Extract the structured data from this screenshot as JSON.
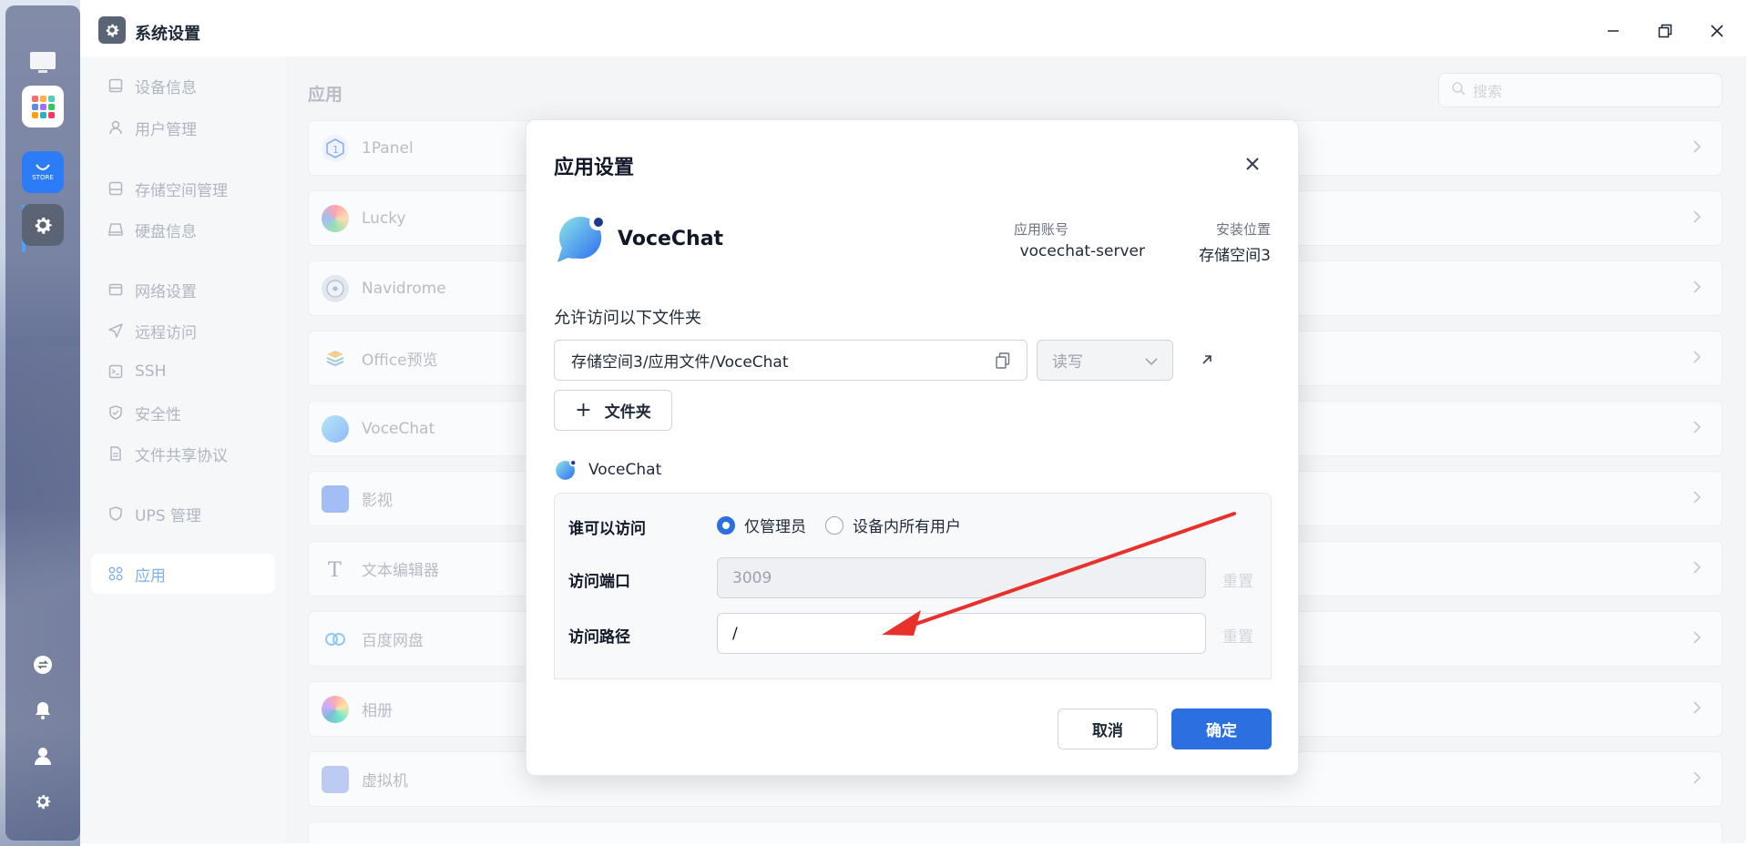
{
  "window": {
    "title": "系统设置"
  },
  "dock": {
    "items": [
      "monitor-icon",
      "apps-grid-icon",
      "store-icon",
      "settings-icon",
      "sync-icon",
      "bell-icon",
      "user-icon",
      "gear-icon"
    ],
    "store_label": "STORE"
  },
  "sidebar": {
    "items": [
      {
        "label": "设备信息",
        "icon": "device-icon"
      },
      {
        "label": "用户管理",
        "icon": "user-icon"
      },
      {
        "label": "存储空间管理",
        "icon": "storage-icon"
      },
      {
        "label": "硬盘信息",
        "icon": "disk-icon"
      },
      {
        "label": "网络设置",
        "icon": "network-icon"
      },
      {
        "label": "远程访问",
        "icon": "send-icon"
      },
      {
        "label": "SSH",
        "icon": "terminal-icon"
      },
      {
        "label": "安全性",
        "icon": "shield-check-icon"
      },
      {
        "label": "文件共享协议",
        "icon": "file-icon"
      },
      {
        "label": "UPS 管理",
        "icon": "shield-icon"
      },
      {
        "label": "应用",
        "icon": "apps-icon",
        "active": true
      }
    ]
  },
  "main": {
    "heading": "应用",
    "search_placeholder": "搜索",
    "apps": [
      {
        "name": "1Panel",
        "icon": "1panel-icon"
      },
      {
        "name": "Lucky",
        "icon": "lucky-icon"
      },
      {
        "name": "Navidrome",
        "icon": "navidrome-icon"
      },
      {
        "name": "Office预览",
        "icon": "office-icon"
      },
      {
        "name": "VoceChat",
        "icon": "vocechat-icon"
      },
      {
        "name": "影视",
        "icon": "video-icon"
      },
      {
        "name": "文本编辑器",
        "icon": "text-editor-icon"
      },
      {
        "name": "百度网盘",
        "icon": "baidu-icon"
      },
      {
        "name": "相册",
        "icon": "photos-icon"
      },
      {
        "name": "虚拟机",
        "icon": "vm-icon"
      }
    ]
  },
  "modal": {
    "title": "应用设置",
    "app_name": "VoceChat",
    "account_label": "应用账号",
    "account_value": "vocechat-server",
    "location_label": "安装位置",
    "location_value": "存储空间3",
    "folders_label": "允许访问以下文件夹",
    "folder_path": "存储空间3/应用文件/VoceChat",
    "permission": "读写",
    "add_folder_label": "文件夹",
    "sub_app_name": "VoceChat",
    "who_label": "谁可以访问",
    "option_admin": "仅管理员",
    "option_all": "设备内所有用户",
    "selected_option": "仅管理员",
    "port_label": "访问端口",
    "port_value": "3009",
    "path_label": "访问路径",
    "path_value": "/",
    "reset_label": "重置",
    "cancel_label": "取消",
    "ok_label": "确定"
  },
  "colors": {
    "primary": "#2b6fe0",
    "annotation_arrow": "#e8312a"
  }
}
